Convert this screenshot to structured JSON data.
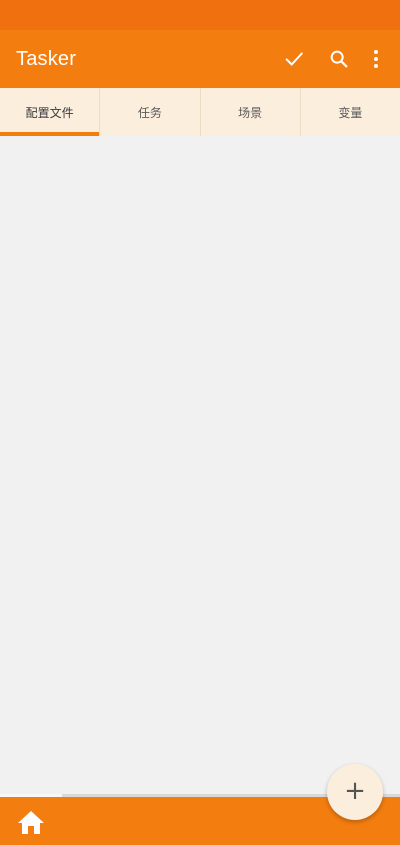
{
  "app": {
    "title": "Tasker"
  },
  "toolbar": {
    "actions": [
      "check-icon",
      "search-icon",
      "more-vert-icon"
    ]
  },
  "tabs": [
    {
      "label": "配置文件",
      "active": true
    },
    {
      "label": "任务",
      "active": false
    },
    {
      "label": "场景",
      "active": false
    },
    {
      "label": "变量",
      "active": false
    }
  ],
  "bottom_bar": {
    "home_icon": "home-icon"
  },
  "fab": {
    "label": "+"
  },
  "colors": {
    "status_bar": "#f07010",
    "primary": "#f47d10",
    "tab_background": "#fbeedd",
    "content_background": "#f2f1f1"
  }
}
